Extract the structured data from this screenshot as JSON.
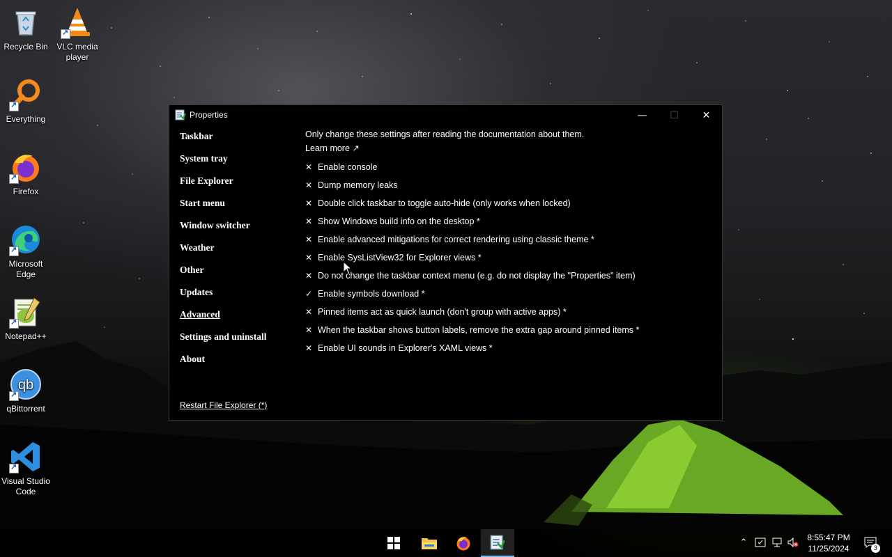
{
  "desktop": {
    "icons": [
      {
        "label": "Recycle Bin",
        "icon": "recycle-bin-icon"
      },
      {
        "label": "VLC media player",
        "icon": "vlc-icon"
      },
      {
        "label": "Everything",
        "icon": "everything-search-icon"
      },
      {
        "label": "Firefox",
        "icon": "firefox-icon"
      },
      {
        "label": "Microsoft Edge",
        "icon": "edge-icon"
      },
      {
        "label": "Notepad++",
        "icon": "notepadpp-icon"
      },
      {
        "label": "qBittorrent",
        "icon": "qbittorrent-icon"
      },
      {
        "label": "Visual Studio Code",
        "icon": "vscode-icon"
      }
    ]
  },
  "window": {
    "title": "Properties",
    "controls": {
      "minimize": "—",
      "maximize": "☐",
      "close": "✕"
    },
    "nav": [
      {
        "label": "Taskbar",
        "active": false
      },
      {
        "label": "System tray",
        "active": false
      },
      {
        "label": "File Explorer",
        "active": false
      },
      {
        "label": "Start menu",
        "active": false
      },
      {
        "label": "Window switcher",
        "active": false
      },
      {
        "label": "Weather",
        "active": false
      },
      {
        "label": "Other",
        "active": false
      },
      {
        "label": "Updates",
        "active": false
      },
      {
        "label": "Advanced",
        "active": true
      },
      {
        "label": "Settings and uninstall",
        "active": false
      },
      {
        "label": "About",
        "active": false
      }
    ],
    "restart_link": "Restart File Explorer (*)",
    "content": {
      "notice": "Only change these settings after reading the documentation about them.",
      "learn_more": "Learn more ↗",
      "options": [
        {
          "mark": "✕",
          "checked": false,
          "label": "Enable console"
        },
        {
          "mark": "✕",
          "checked": false,
          "label": "Dump memory leaks"
        },
        {
          "mark": "✕",
          "checked": false,
          "label": "Double click taskbar to toggle auto-hide (only works when locked)"
        },
        {
          "mark": "✕",
          "checked": false,
          "label": "Show Windows build info on the desktop *"
        },
        {
          "mark": "✕",
          "checked": false,
          "label": "Enable advanced mitigations for correct rendering using classic theme *"
        },
        {
          "mark": "✕",
          "checked": false,
          "label": "Enable SysListView32 for Explorer views *"
        },
        {
          "mark": "✕",
          "checked": false,
          "label": "Do not change the taskbar context menu (e.g. do not display the \"Properties\" item)"
        },
        {
          "mark": "✓",
          "checked": true,
          "label": "Enable symbols download *"
        },
        {
          "mark": "✕",
          "checked": false,
          "label": "Pinned items act as quick launch (don't group with active apps) *"
        },
        {
          "mark": "✕",
          "checked": false,
          "label": "When the taskbar shows button labels, remove the extra gap around pinned items *"
        },
        {
          "mark": "✕",
          "checked": false,
          "label": "Enable UI sounds in Explorer's XAML views *"
        }
      ]
    }
  },
  "taskbar": {
    "buttons": [
      "start-icon",
      "file-explorer-icon",
      "firefox-icon",
      "properties-app-icon"
    ],
    "tray": [
      "chevron-up-icon",
      "security-icon",
      "network-icon",
      "volume-muted-icon"
    ],
    "time": "8:55:47 PM",
    "date": "11/25/2024",
    "notification_count": "3"
  }
}
